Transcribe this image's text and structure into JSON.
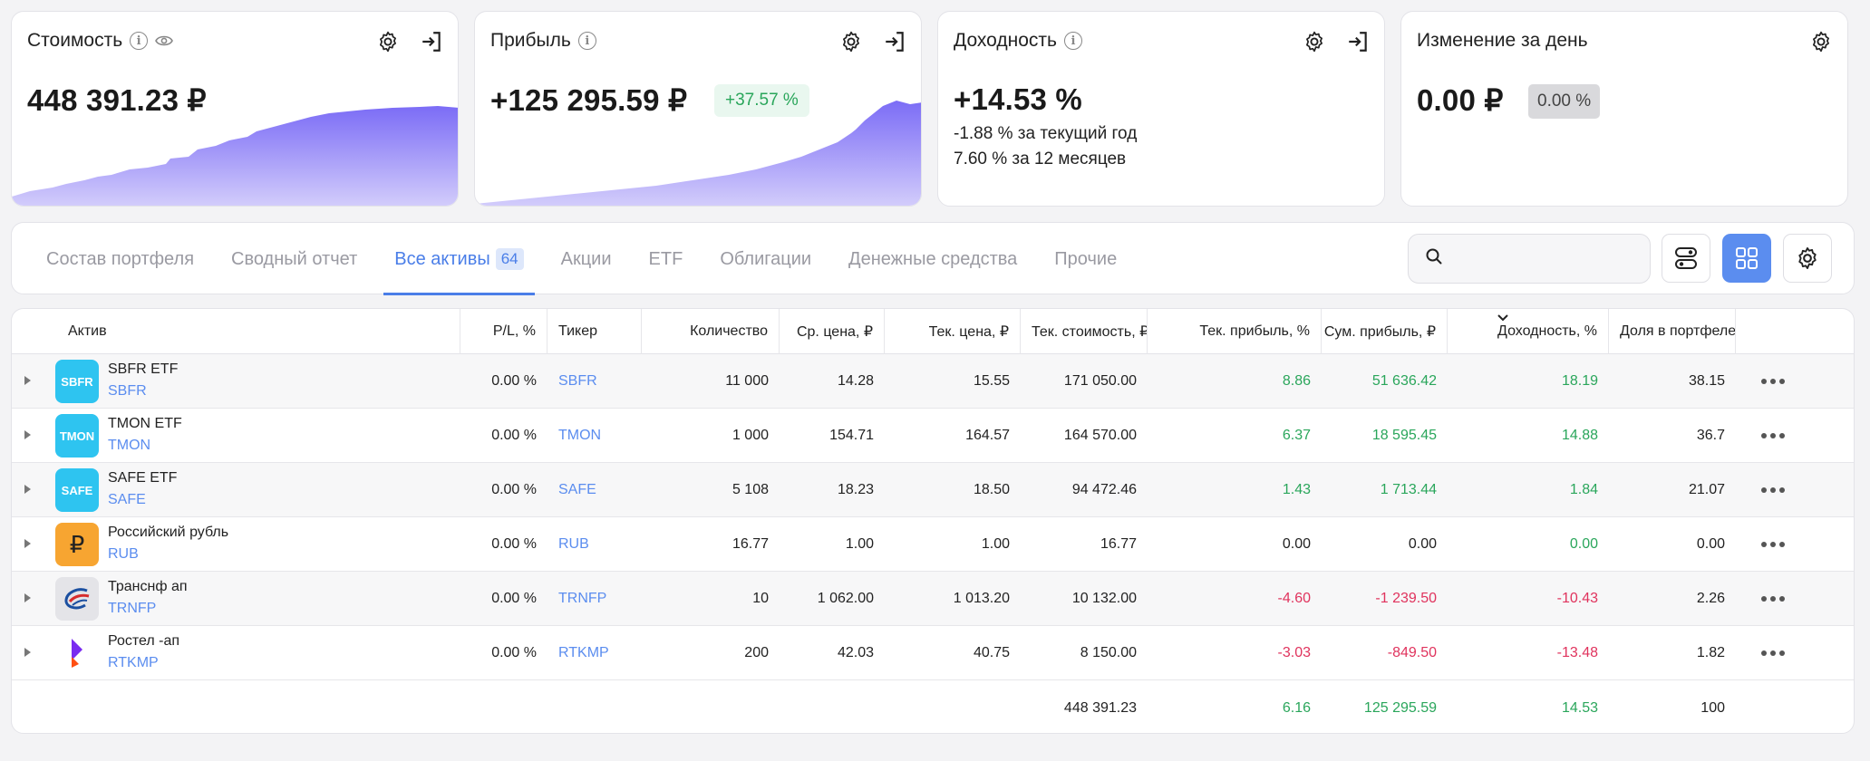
{
  "cards": [
    {
      "title": "Стоимость",
      "value": "448 391.23 ₽"
    },
    {
      "title": "Прибыль",
      "value": "+125 295.59 ₽",
      "badge": "+37.57 %"
    },
    {
      "title": "Доходность",
      "value": "+14.53 %",
      "line1": "-1.88 % за текущий год",
      "line2": "7.60 % за 12 месяцев"
    },
    {
      "title": "Изменение за день",
      "value": "0.00 ₽",
      "badge": "0.00 %"
    }
  ],
  "tabs": [
    {
      "label": "Состав портфеля"
    },
    {
      "label": "Сводный отчет"
    },
    {
      "label": "Все активы",
      "count": "64"
    },
    {
      "label": "Акции"
    },
    {
      "label": "ETF"
    },
    {
      "label": "Облигации"
    },
    {
      "label": "Денежные средства"
    },
    {
      "label": "Прочие"
    }
  ],
  "search": {
    "value": "",
    "placeholder": ""
  },
  "table": {
    "columns": [
      "Актив",
      "P/L, %",
      "Тикер",
      "Количество",
      "Ср. цена, ₽",
      "Тек. цена, ₽",
      "Тек. стоимость, ₽",
      "Тек. прибыль, %",
      "Сум. прибыль, ₽",
      "Доходность, %",
      "Доля в портфеле"
    ],
    "rows": [
      {
        "name": "SBFR ETF",
        "ticker": "SBFR",
        "logo": "SBFR",
        "logo_color": "#2ec4f0",
        "pl": "0.00 %",
        "qty": "11 000",
        "avg": "14.28",
        "cur": "15.55",
        "value": "171 050.00",
        "profit_pct": "8.86",
        "profit_sum": "51 636.42",
        "yield": "18.19",
        "share": "38.15",
        "sign": "pos"
      },
      {
        "name": "TMON ETF",
        "ticker": "TMON",
        "logo": "TMON",
        "logo_color": "#2ec4f0",
        "pl": "0.00 %",
        "qty": "1 000",
        "avg": "154.71",
        "cur": "164.57",
        "value": "164 570.00",
        "profit_pct": "6.37",
        "profit_sum": "18 595.45",
        "yield": "14.88",
        "share": "36.7",
        "sign": "pos"
      },
      {
        "name": "SAFE ETF",
        "ticker": "SAFE",
        "logo": "SAFE",
        "logo_color": "#2ec4f0",
        "pl": "0.00 %",
        "qty": "5 108",
        "avg": "18.23",
        "cur": "18.50",
        "value": "94 472.46",
        "profit_pct": "1.43",
        "profit_sum": "1 713.44",
        "yield": "1.84",
        "share": "21.07",
        "sign": "pos"
      },
      {
        "name": "Российский рубль",
        "ticker": "RUB",
        "logo": "₽",
        "logo_color": "#f7a531",
        "pl": "0.00 %",
        "qty": "16.77",
        "avg": "1.00",
        "cur": "1.00",
        "value": "16.77",
        "profit_pct": "0.00",
        "profit_sum": "0.00",
        "yield": "0.00",
        "share": "0.00",
        "sign": "zero"
      },
      {
        "name": "Транснф ап",
        "ticker": "TRNFP",
        "logo": "",
        "logo_color": "#e4e4e8",
        "pl": "0.00 %",
        "qty": "10",
        "avg": "1 062.00",
        "cur": "1 013.20",
        "value": "10 132.00",
        "profit_pct": "-4.60",
        "profit_sum": "-1 239.50",
        "yield": "-10.43",
        "share": "2.26",
        "sign": "neg"
      },
      {
        "name": "Ростел -ап",
        "ticker": "RTKMP",
        "logo": "",
        "logo_color": "#ffffff",
        "pl": "0.00 %",
        "qty": "200",
        "avg": "42.03",
        "cur": "40.75",
        "value": "8 150.00",
        "profit_pct": "-3.03",
        "profit_sum": "-849.50",
        "yield": "-13.48",
        "share": "1.82",
        "sign": "neg"
      }
    ],
    "totals": {
      "value": "448 391.23",
      "profit_pct": "6.16",
      "profit_sum": "125 295.59",
      "yield": "14.53",
      "share": "100"
    }
  },
  "colors": {
    "accent": "#5b8def",
    "positive": "#2aa65b",
    "negative": "#e0335d",
    "chart": "#7b6cf6"
  }
}
